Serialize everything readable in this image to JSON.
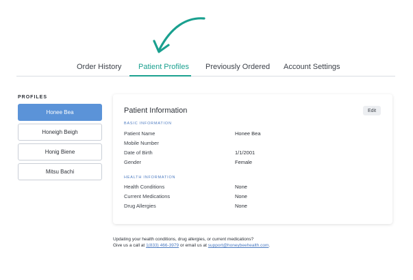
{
  "nav": {
    "tabs": [
      {
        "label": "Order History"
      },
      {
        "label": "Patient Profiles"
      },
      {
        "label": "Previously Ordered"
      },
      {
        "label": "Account Settings"
      }
    ],
    "active_tab": "Patient Profiles"
  },
  "sidebar": {
    "heading": "PROFILES",
    "profiles": [
      {
        "name": "Honee Bea"
      },
      {
        "name": "Honeigh Beigh"
      },
      {
        "name": "Honig Biene"
      },
      {
        "name": "Mitsu Bachi"
      }
    ],
    "selected": "Honee Bea"
  },
  "card": {
    "title": "Patient Information",
    "edit_label": "Edit",
    "basic": {
      "heading": "BASIC INFORMATION",
      "rows": [
        {
          "label": "Patient Name",
          "value": "Honee Bea"
        },
        {
          "label": "Mobile Number",
          "value": ""
        },
        {
          "label": "Date of Birth",
          "value": "1/1/2001"
        },
        {
          "label": "Gender",
          "value": "Female"
        }
      ]
    },
    "health": {
      "heading": "HEALTH INFORMATION",
      "rows": [
        {
          "label": "Health Conditions",
          "value": "None"
        },
        {
          "label": "Current Medications",
          "value": "None"
        },
        {
          "label": "Drug Allergies",
          "value": "None"
        }
      ]
    }
  },
  "footer": {
    "line1": "Updating your health conditions, drug allergies, or current medications?",
    "line2_prefix": "Give us a call at ",
    "phone": "1(833) 466-3979",
    "line2_middle": " or email us at ",
    "email": "support@honeybeehealth.com",
    "line2_suffix": "."
  },
  "colors": {
    "accent": "#1aa08f",
    "selected_profile": "#5b93d8",
    "link": "#4a79c0"
  }
}
